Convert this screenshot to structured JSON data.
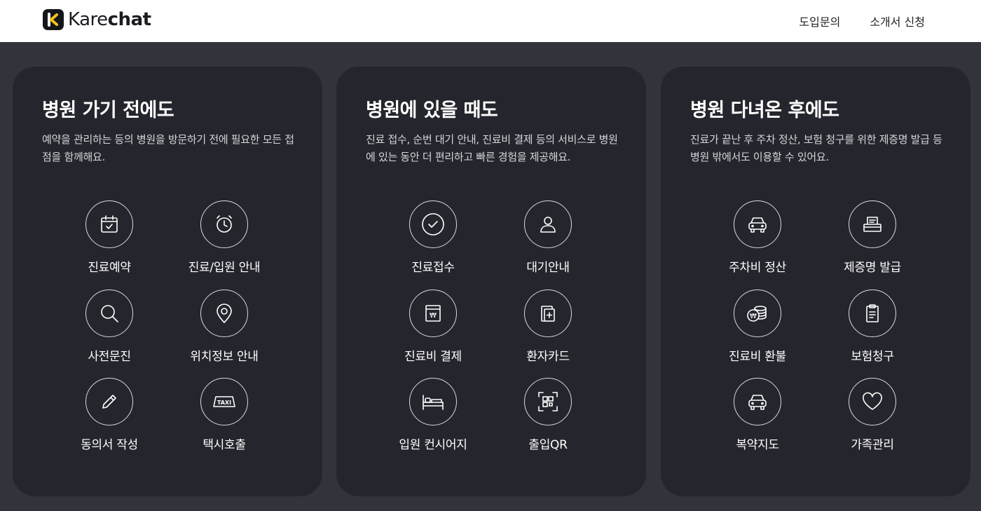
{
  "header": {
    "logo_light": "Kare",
    "logo_bold": "chat",
    "nav": [
      "도입문의",
      "소개서 신청"
    ]
  },
  "cards": [
    {
      "title": "병원 가기 전에도",
      "desc": "예약을 관리하는 등의 병원을 방문하기 전에 필요한 모든 접점을 함께해요.",
      "features": [
        {
          "label": "진료예약",
          "icon": "calendar-icon"
        },
        {
          "label": "진료/입원 안내",
          "icon": "alarm-clock-icon"
        },
        {
          "label": "사전문진",
          "icon": "search-icon"
        },
        {
          "label": "위치정보 안내",
          "icon": "location-pin-icon"
        },
        {
          "label": "동의서 작성",
          "icon": "pencil-icon"
        },
        {
          "label": "택시호출",
          "icon": "taxi-icon"
        }
      ]
    },
    {
      "title": "병원에 있을 때도",
      "desc": "진료 접수, 순번 대기 안내, 진료비 결제 등의 서비스로 병원에 있는 동안 더 편리하고 빠른 경험을 제공해요.",
      "features": [
        {
          "label": "진료접수",
          "icon": "check-circle-icon"
        },
        {
          "label": "대기안내",
          "icon": "person-icon"
        },
        {
          "label": "진료비 결제",
          "icon": "won-payment-icon"
        },
        {
          "label": "환자카드",
          "icon": "patient-card-icon"
        },
        {
          "label": "입원 컨시어지",
          "icon": "bed-icon"
        },
        {
          "label": "출입QR",
          "icon": "qr-scan-icon"
        }
      ]
    },
    {
      "title": "병원 다녀온 후에도",
      "desc": "진료가 끝난 후 주차 정산, 보험 청구를 위한 제증명 발급 등 병원 밖에서도 이용할 수 있어요.",
      "features": [
        {
          "label": "주차비 정산",
          "icon": "car-icon"
        },
        {
          "label": "제증명 발급",
          "icon": "printer-icon"
        },
        {
          "label": "진료비 환불",
          "icon": "coin-refund-icon"
        },
        {
          "label": "보험청구",
          "icon": "clipboard-icon"
        },
        {
          "label": "복약지도",
          "icon": "car-icon"
        },
        {
          "label": "가족관리",
          "icon": "heart-icon"
        }
      ]
    }
  ]
}
